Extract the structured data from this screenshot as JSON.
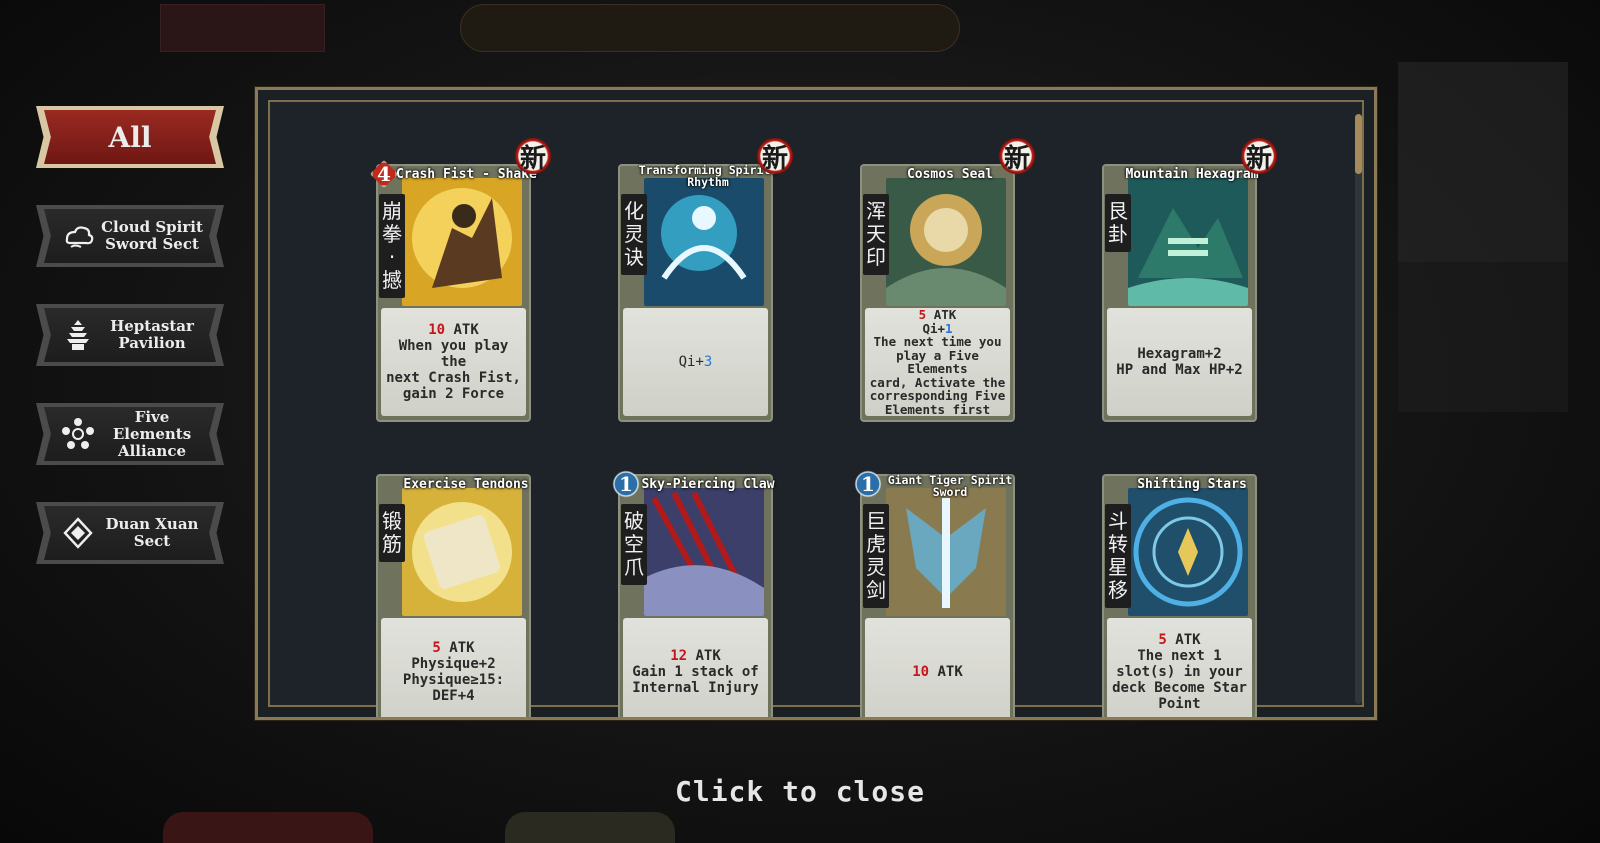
{
  "tabs": [
    {
      "label": "All",
      "icon": "all",
      "active": true
    },
    {
      "label": "Cloud Spirit Sword Sect",
      "icon": "cloud-icon",
      "active": false
    },
    {
      "label": "Heptastar Pavilion",
      "icon": "pagoda-icon",
      "active": false
    },
    {
      "label": "Five Elements Alliance",
      "icon": "five-elements-icon",
      "active": false
    },
    {
      "label": "Duan Xuan Sect",
      "icon": "duan-xuan-icon",
      "active": false
    }
  ],
  "new_badge": "新",
  "cards": [
    {
      "name": "Crash Fist - Shake",
      "vertical": "崩拳·撼",
      "cost": "4",
      "desc_lines": [
        [
          "10",
          " ATK"
        ],
        [
          "When you play the"
        ],
        [
          "next Crash Fist,"
        ],
        [
          "gain 2 Force"
        ]
      ]
    },
    {
      "name": "Transforming Spirits Rhythm",
      "vertical": "化灵诀",
      "cost": "",
      "desc_lines": [
        [
          "Qi+",
          "3"
        ]
      ]
    },
    {
      "name": "Cosmos Seal",
      "vertical": "浑天印",
      "cost": "",
      "desc_lines": [
        [
          "5",
          " ATK"
        ],
        [
          "Qi+",
          "1"
        ],
        [
          "The next time you"
        ],
        [
          "play a Five Elements"
        ],
        [
          "card, Activate the"
        ],
        [
          "corresponding Five"
        ],
        [
          "Elements first"
        ]
      ]
    },
    {
      "name": "Mountain Hexagram",
      "vertical": "艮卦",
      "cost": "",
      "desc_lines": [
        [
          "Hexagram+2"
        ],
        [
          "HP and Max HP+2"
        ]
      ]
    },
    {
      "name": "Exercise Tendons",
      "vertical": "锻筋",
      "cost": "",
      "desc_lines": [
        [
          "5",
          " ATK"
        ],
        [
          "Physique+2"
        ],
        [
          "Physique≥15:"
        ],
        [
          "DEF+4"
        ]
      ]
    },
    {
      "name": "Sky-Piercing Claw",
      "vertical": "破空爪",
      "cost": "1",
      "desc_lines": [
        [
          "12",
          " ATK"
        ],
        [
          "Gain 1 stack of"
        ],
        [
          "Internal Injury"
        ]
      ]
    },
    {
      "name": "Giant Tiger Spirit Sword",
      "vertical": "巨虎灵剑",
      "cost": "1",
      "desc_lines": [
        [
          "10",
          " ATK"
        ]
      ]
    },
    {
      "name": "Shifting Stars",
      "vertical": "斗转星移",
      "cost": "",
      "desc_lines": [
        [
          "5",
          " ATK"
        ],
        [
          "The next 1"
        ],
        [
          "slot(s) in your"
        ],
        [
          "deck Become Star"
        ],
        [
          "Point"
        ]
      ]
    }
  ],
  "close_hint": "Click to close",
  "colors": {
    "accent_red": "#c4161c",
    "qi_blue": "#2a78d6",
    "frame_gold": "#8a7a55"
  }
}
